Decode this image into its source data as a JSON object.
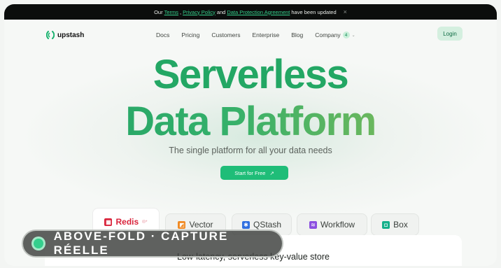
{
  "announcement": {
    "prefix": "Our ",
    "terms": "Terms",
    "sep1": ", ",
    "privacy": "Privacy Policy",
    "and": " and ",
    "dpa": "Data Protection Agreement",
    "suffix": " have been updated",
    "close": "×"
  },
  "brand": {
    "name": "upstash"
  },
  "nav": {
    "items": [
      "Docs",
      "Pricing",
      "Customers",
      "Enterprise",
      "Blog"
    ],
    "company": "Company",
    "company_badge": "4",
    "login": "Login"
  },
  "hero": {
    "line1": "Serverless",
    "line2": "Data Platform",
    "subtitle": "The single platform for all your data needs",
    "cta": "Start for Free",
    "cta_arrow": "↗"
  },
  "products": {
    "tabs": [
      {
        "label": "Redis",
        "tag": "®*",
        "icon": "redis-icon",
        "color": "#d9233b"
      },
      {
        "label": "Vector",
        "icon": "vector-icon",
        "color": "#f08a24"
      },
      {
        "label": "QStash",
        "icon": "qstash-icon",
        "color": "#2f6fe0"
      },
      {
        "label": "Workflow",
        "icon": "workflow-icon",
        "color": "#8b4fe0"
      },
      {
        "label": "Box",
        "icon": "box-icon",
        "color": "#14b08a"
      }
    ],
    "panel_title": "Low-latency, serverless key-value store"
  },
  "overlay": {
    "text": "ABOVE-FOLD · CAPTURE RÉELLE"
  }
}
